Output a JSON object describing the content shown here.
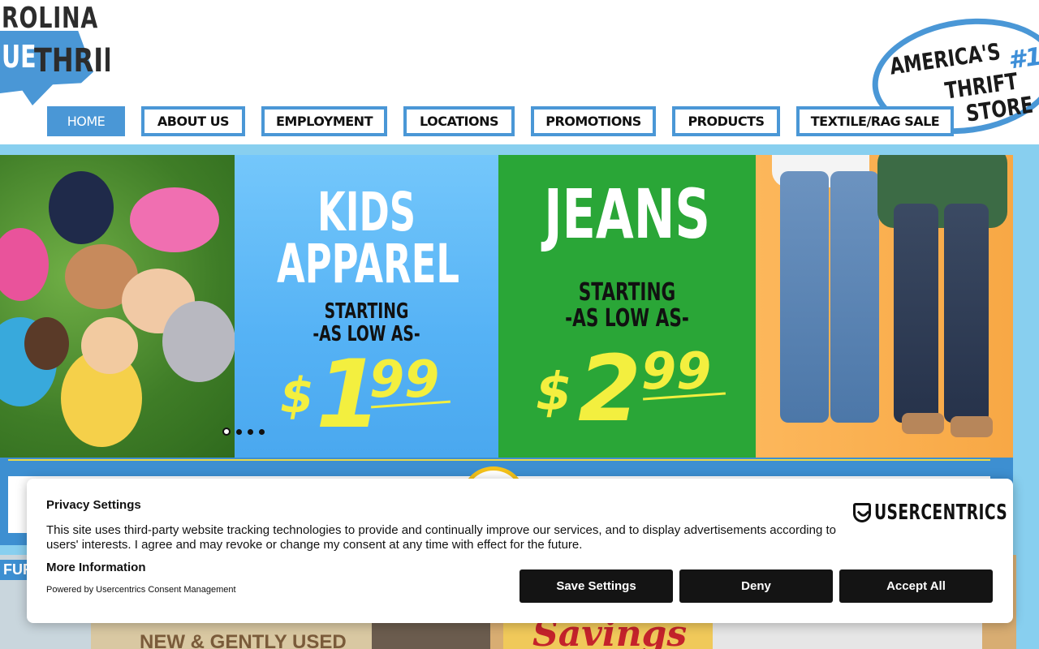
{
  "logo": {
    "line1": "ROLINA",
    "line2a": "UE",
    "line2b": "THRIFT"
  },
  "badge": {
    "line1": "AMERICA'S",
    "line2": "THRIFT",
    "line3": "STORE",
    "rank": "#1"
  },
  "nav": {
    "items": [
      {
        "label": "HOME"
      },
      {
        "label": "ABOUT US"
      },
      {
        "label": "EMPLOYMENT"
      },
      {
        "label": "LOCATIONS"
      },
      {
        "label": "PROMOTIONS"
      },
      {
        "label": "PRODUCTS"
      },
      {
        "label": "TEXTILE/RAG SALE"
      }
    ],
    "active_index": 0
  },
  "hero": {
    "kids": {
      "headline1": "KIDS",
      "headline2": "APPAREL",
      "sub1": "STARTING",
      "sub2": "-AS LOW AS-",
      "price_dollar": "$",
      "price_main": "1",
      "price_cents": "99"
    },
    "jeans": {
      "headline": "JEANS",
      "sub1": "STARTING",
      "sub2": "-AS LOW AS-",
      "price_dollar": "$",
      "price_main": "2",
      "price_cents": "99"
    },
    "slide_count": 4,
    "active_slide": 1
  },
  "lower_cards": {
    "card1_label": "FURI",
    "card2_text": "NEW & GENTLY USED",
    "card4_text": "Savings"
  },
  "consent": {
    "title": "Privacy Settings",
    "body": "This site uses third-party website tracking technologies to provide and continually improve our services, and to display advertisements according to users' interests. I agree and may revoke or change my consent at any time with effect for the future.",
    "more_info": "More Information",
    "powered_by": "Powered by Usercentrics Consent Management",
    "brand": "USERCENTRICS",
    "buttons": {
      "save": "Save Settings",
      "deny": "Deny",
      "accept": "Accept All"
    }
  },
  "colors": {
    "brand_blue": "#4a97d6",
    "sky": "#88cfef",
    "price_yellow": "#f3ef3f",
    "jeans_green": "#2aa637",
    "button_dark": "#141414"
  }
}
